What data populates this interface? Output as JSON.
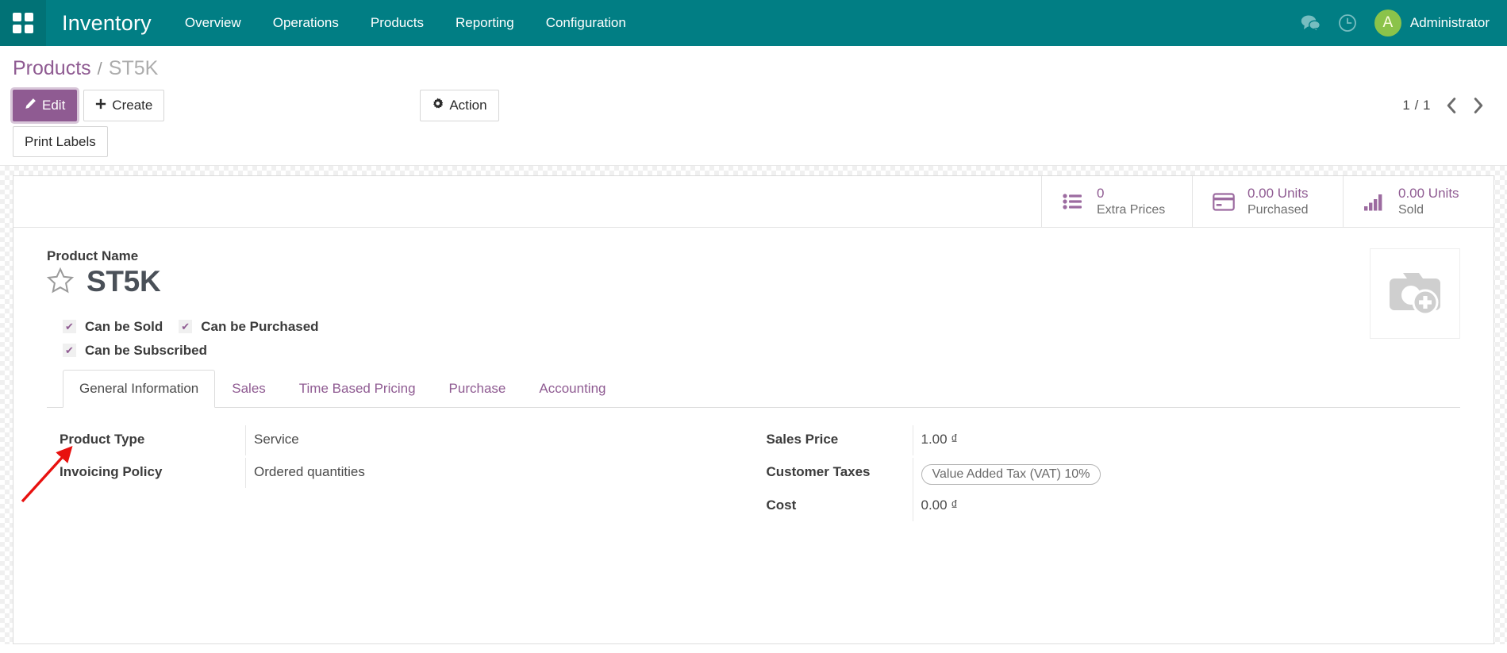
{
  "navbar": {
    "apps_icon": "apps-grid-icon",
    "brand": "Inventory",
    "menu": [
      {
        "label": "Overview"
      },
      {
        "label": "Operations"
      },
      {
        "label": "Products"
      },
      {
        "label": "Reporting"
      },
      {
        "label": "Configuration"
      }
    ],
    "messages_icon": "chat-bubbles-icon",
    "activities_icon": "clock-icon",
    "avatar_initial": "A",
    "user_name": "Administrator",
    "bg_color": "#017e84",
    "avatar_color": "#8bc34a"
  },
  "breadcrumb": {
    "parent": "Products",
    "separator": "/",
    "current": "ST5K"
  },
  "toolbar": {
    "edit_label": "Edit",
    "edit_icon": "pencil-icon",
    "create_label": "Create",
    "create_icon": "plus-icon",
    "action_label": "Action",
    "action_icon": "gear-icon",
    "print_labels_label": "Print Labels",
    "accent_color": "#8f5b92"
  },
  "pager": {
    "count": "1 / 1",
    "prev_icon": "chevron-left-icon",
    "next_icon": "chevron-right-icon"
  },
  "stat_buttons": [
    {
      "value": "0",
      "label": "Extra Prices",
      "icon": "list-ul-icon"
    },
    {
      "value": "0.00 Units",
      "label": "Purchased",
      "icon": "credit-card-icon"
    },
    {
      "value": "0.00 Units",
      "label": "Sold",
      "icon": "bar-chart-icon"
    }
  ],
  "product": {
    "name_label": "Product Name",
    "name": "ST5K",
    "favorite_icon": "star-outline-icon",
    "image_placeholder_icon": "camera-plus-icon"
  },
  "checkboxes": [
    {
      "label": "Can be Sold",
      "checked": true
    },
    {
      "label": "Can be Purchased",
      "checked": true
    },
    {
      "label": "Can be Subscribed",
      "checked": true
    }
  ],
  "tabs": [
    {
      "label": "General Information",
      "active": true
    },
    {
      "label": "Sales",
      "active": false
    },
    {
      "label": "Time Based Pricing",
      "active": false
    },
    {
      "label": "Purchase",
      "active": false
    },
    {
      "label": "Accounting",
      "active": false
    }
  ],
  "form": {
    "left": [
      {
        "label": "Product Type",
        "value": "Service"
      },
      {
        "label": "Invoicing Policy",
        "value": "Ordered quantities"
      }
    ],
    "right": [
      {
        "label": "Sales Price",
        "value": "1.00 ₫"
      },
      {
        "label": "Customer Taxes",
        "value": "Value Added Tax (VAT) 10%"
      },
      {
        "label": "Cost",
        "value": "0.00 ₫"
      }
    ]
  },
  "annotation": {
    "arrow_color": "#e8110f",
    "points_to": "Can be Subscribed"
  }
}
